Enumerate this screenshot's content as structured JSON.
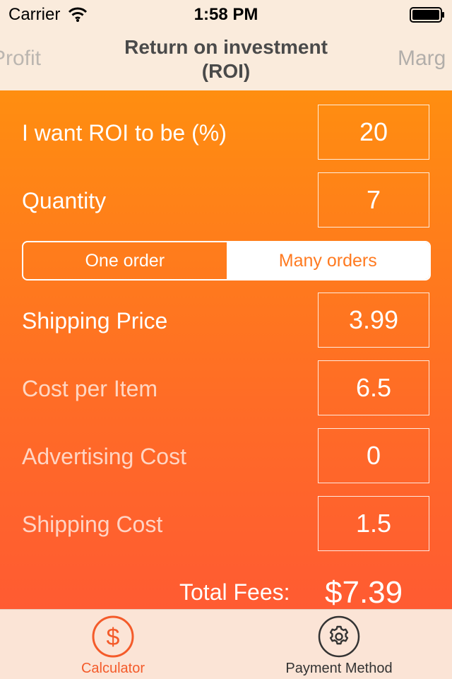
{
  "status_bar": {
    "carrier": "Carrier",
    "time": "1:58 PM"
  },
  "nav": {
    "title": "Return on investment (ROI)",
    "prev_page": "Profit",
    "next_page": "Marg"
  },
  "form": {
    "roi": {
      "label": "I want ROI to be (%)",
      "value": "20"
    },
    "quantity": {
      "label": "Quantity",
      "value": "7"
    },
    "order_mode": {
      "options": [
        "One order",
        "Many orders"
      ],
      "selected": "Many orders"
    },
    "shipping_price": {
      "label": "Shipping Price",
      "value": "3.99"
    },
    "cost_per_item": {
      "label": "Cost per Item",
      "value": "6.5"
    },
    "advertising_cost": {
      "label": "Advertising Cost",
      "value": "0"
    },
    "shipping_cost": {
      "label": "Shipping Cost",
      "value": "1.5"
    },
    "total_fees": {
      "label": "Total Fees:",
      "value": "$7.39"
    }
  },
  "tabbar": {
    "calculator": {
      "label": "Calculator",
      "icon": "dollar-icon",
      "selected": true
    },
    "payment_method": {
      "label": "Payment Method",
      "icon": "gear-icon",
      "selected": false
    }
  },
  "colors": {
    "accent": "#f45b2a",
    "gradient_top": "#ff8e10",
    "gradient_bottom": "#ff5b32",
    "header_bg": "#faebdc"
  }
}
